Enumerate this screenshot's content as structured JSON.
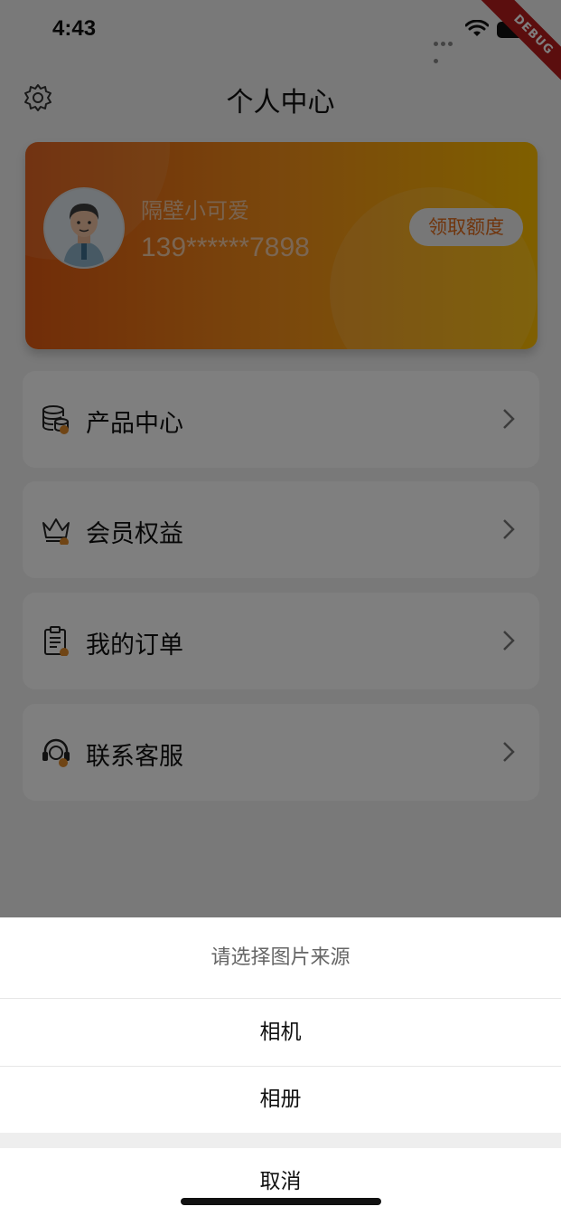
{
  "status_bar": {
    "time": "4:43",
    "debug_label": "DEBUG"
  },
  "header": {
    "title": "个人中心",
    "settings_icon": "gear-icon"
  },
  "profile": {
    "name": "隔壁小可爱",
    "phone": "139******7898",
    "claim_button": "领取额度",
    "avatar_icon": "avatar-icon",
    "colors": {
      "gradient_start": "#e25a12",
      "gradient_end": "#ffbf00"
    }
  },
  "menu": {
    "items": [
      {
        "label": "产品中心",
        "icon": "database-icon"
      },
      {
        "label": "会员权益",
        "icon": "crown-icon"
      },
      {
        "label": "我的订单",
        "icon": "clipboard-icon"
      },
      {
        "label": "联系客服",
        "icon": "headset-icon"
      }
    ],
    "accent_dot_color": "#e08a2a"
  },
  "action_sheet": {
    "title": "请选择图片来源",
    "options": [
      "相机",
      "相册"
    ],
    "cancel": "取消"
  }
}
